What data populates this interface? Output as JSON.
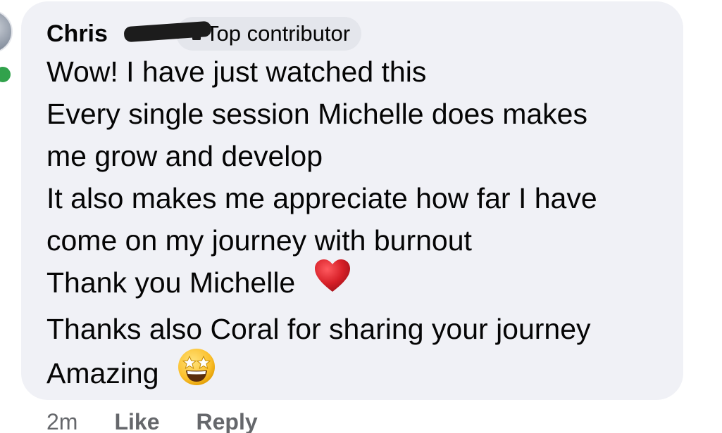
{
  "comment": {
    "author": "Chris",
    "badge": "Top contributor",
    "badge_icon": "contributor-badge-icon",
    "lines": [
      "Wow! I have just watched this",
      "Every single session Michelle does makes",
      "me grow and develop",
      "It also makes me appreciate how far I have",
      "come on my journey with burnout",
      "Thank you Michelle",
      "Thanks also Coral for sharing your journey",
      "Amazing"
    ],
    "emoji": {
      "heart": "red-heart-emoji",
      "star_struck": "star-struck-emoji"
    }
  },
  "footer": {
    "time": "2m",
    "like_label": "Like",
    "reply_label": "Reply"
  },
  "colors": {
    "bubble_background": "#f0f1f6",
    "badge_background": "#e4e6ec",
    "text": "#050505",
    "secondary_text": "#65676b",
    "online_indicator": "#31a24c",
    "heart": "#d61f27"
  }
}
